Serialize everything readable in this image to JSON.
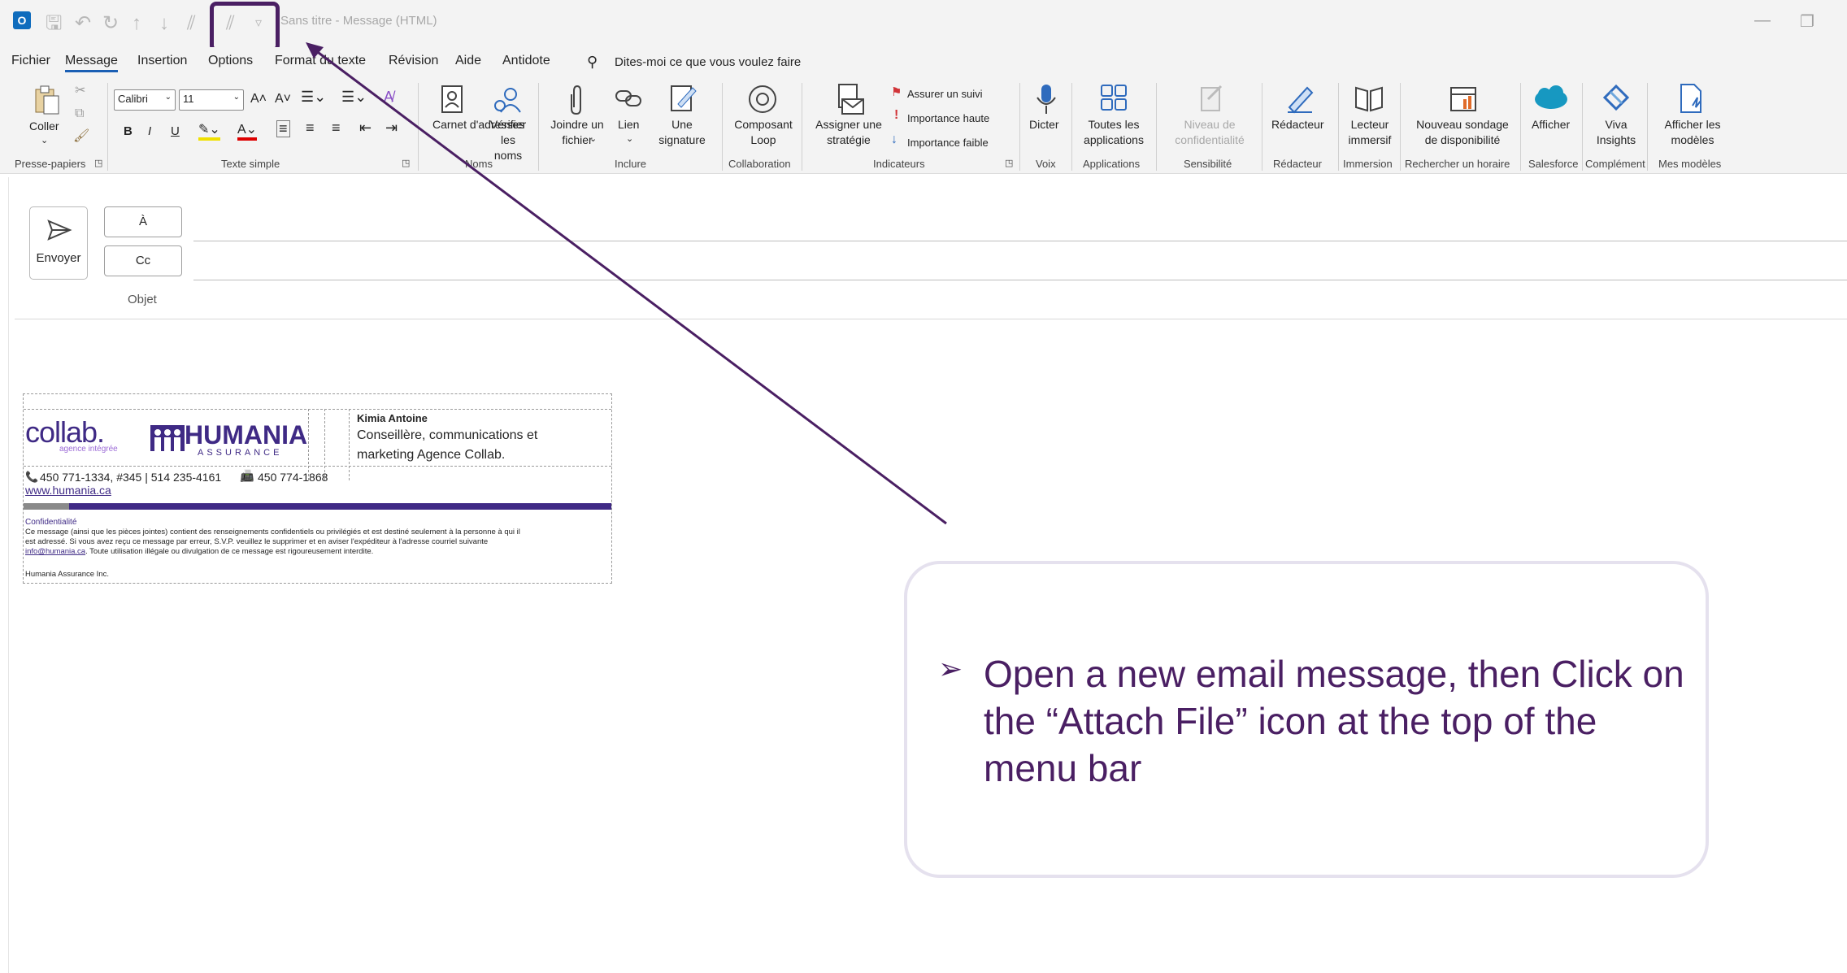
{
  "window": {
    "title": "Sans titre  -  Message (HTML)"
  },
  "menu_tabs": [
    "Fichier",
    "Message",
    "Insertion",
    "Options",
    "Format du texte",
    "Révision",
    "Aide",
    "Antidote"
  ],
  "tell_me": "Dites-moi ce que vous voulez faire",
  "ribbon": {
    "clipboard": {
      "paste": "Coller",
      "group": "Presse-papiers"
    },
    "font": {
      "name": "Calibri",
      "size": "11",
      "group": "Texte simple",
      "bold": "B",
      "italic": "I",
      "underline": "U"
    },
    "names": {
      "address_book": "Carnet d'adresses",
      "check_names": "Vérifier les noms",
      "group": "Noms"
    },
    "include": {
      "attach": "Joindre un fichier",
      "link": "Lien",
      "signature": "Une signature",
      "group": "Inclure"
    },
    "collab": {
      "loop": "Composant Loop",
      "group": "Collaboration"
    },
    "tags": {
      "assign": "Assigner une stratégie",
      "follow": "Assurer un suivi",
      "high": "Importance haute",
      "low": "Importance faible",
      "group": "Indicateurs"
    },
    "voice": {
      "dictate": "Dicter",
      "group": "Voix"
    },
    "apps": {
      "all": "Toutes les applications",
      "group": "Applications"
    },
    "sensitivity": {
      "level": "Niveau de confidentialité",
      "group": "Sensibilité"
    },
    "editor": {
      "label": "Rédacteur",
      "group": "Rédacteur"
    },
    "immersive": {
      "label": "Lecteur immersif",
      "group": "Immersion"
    },
    "poll": {
      "label": "Nouveau sondage de disponibilité",
      "group": "Rechercher un horaire"
    },
    "salesforce": {
      "label": "Afficher",
      "group": "Salesforce"
    },
    "viva": {
      "label": "Viva Insights",
      "group": "Complément"
    },
    "templates": {
      "label": "Afficher les modèles",
      "group": "Mes modèles"
    }
  },
  "compose": {
    "send": "Envoyer",
    "to": "À",
    "cc": "Cc",
    "subject": "Objet"
  },
  "signature": {
    "logo1": "collab.",
    "logo1_sub": "agence intégrée",
    "logo2": "HUMANIA",
    "logo2_sub": "ASSURANCE",
    "name": "Kimia Antoine",
    "role_line1": "Conseillère, communications et",
    "role_line2": "marketing Agence Collab.",
    "phone1": "450 771-1334, #345  |  514 235-4161",
    "fax": "450 774-1868",
    "website": "www.humania.ca",
    "conf_title": "Confidentialité",
    "conf_text1": "Ce message (ainsi que les pièces jointes) contient des renseignements confidentiels ou privilégiés et est destiné seulement à la personne à qui il",
    "conf_text2": "est adressé. Si vous avez reçu ce message par erreur, S.V.P. veuillez le supprimer et en aviser l'expéditeur à l'adresse courriel suivante",
    "conf_email": "info@humania.ca",
    "conf_text3": ". Toute utilisation illégale ou divulgation de ce message est rigoureusement interdite.",
    "company": "Humania Assurance Inc."
  },
  "callout": {
    "bullet": "➢",
    "text": "Open a new email message, then Click on the “Attach File” icon at the top of the menu bar"
  },
  "colors": {
    "accent": "#4a1f63",
    "outlook_blue": "#1a5fb4",
    "humania_purple": "#3f2a85"
  }
}
